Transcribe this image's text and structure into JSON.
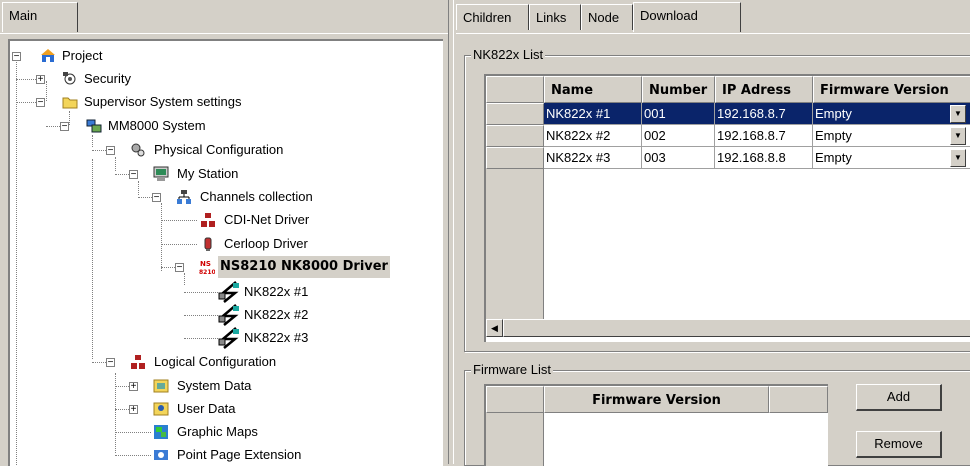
{
  "left_tabs": {
    "main": "Main"
  },
  "tree": [
    {
      "label": "Project",
      "level": 0,
      "expander": "−"
    },
    {
      "label": "Security",
      "level": 1,
      "expander": "+"
    },
    {
      "label": "Supervisor System settings",
      "level": 1,
      "expander": "−"
    },
    {
      "label": "MM8000 System",
      "level": 2,
      "expander": "−"
    },
    {
      "label": "Physical Configuration",
      "level": 3,
      "expander": "−"
    },
    {
      "label": "My Station",
      "level": 4,
      "expander": "−"
    },
    {
      "label": "Channels collection",
      "level": 5,
      "expander": "−"
    },
    {
      "label": "CDI-Net Driver",
      "level": 6,
      "expander": ""
    },
    {
      "label": "Cerloop Driver",
      "level": 6,
      "expander": ""
    },
    {
      "label": "NS8210 NK8000 Driver",
      "level": 6,
      "expander": "−",
      "selected": true
    },
    {
      "label": "NK822x #1",
      "level": 7,
      "expander": ""
    },
    {
      "label": "NK822x #2",
      "level": 7,
      "expander": ""
    },
    {
      "label": "NK822x #3",
      "level": 7,
      "expander": ""
    },
    {
      "label": "Logical Configuration",
      "level": 3,
      "expander": "−"
    },
    {
      "label": "System Data",
      "level": 4,
      "expander": "+"
    },
    {
      "label": "User Data",
      "level": 4,
      "expander": "+"
    },
    {
      "label": "Graphic Maps",
      "level": 4,
      "expander": ""
    },
    {
      "label": "Point Page Extension",
      "level": 4,
      "expander": ""
    }
  ],
  "right_tabs": {
    "children": "Children",
    "links": "Links",
    "node": "Node",
    "download": "Download"
  },
  "nk_list": {
    "title": "NK822x List",
    "headers": {
      "name": "Name",
      "number": "Number",
      "ip": "IP Adress",
      "firmware": "Firmware Version"
    },
    "rows": [
      {
        "name": "NK822x #1",
        "number": "001",
        "ip": "192.168.8.7",
        "firmware": "Empty"
      },
      {
        "name": "NK822x #2",
        "number": "002",
        "ip": "192.168.8.7",
        "firmware": "Empty"
      },
      {
        "name": "NK822x #3",
        "number": "003",
        "ip": "192.168.8.8",
        "firmware": "Empty"
      }
    ]
  },
  "firmware_list": {
    "title": "Firmware List",
    "header": "Firmware Version",
    "add_label": "Add",
    "remove_label": "Remove"
  },
  "colors": {
    "selection": "#0a246a",
    "face": "#d4d0c8"
  },
  "icons": [
    "project-icon",
    "security-icon",
    "folder-icon",
    "system-icon",
    "physical-config-icon",
    "station-icon",
    "channels-icon",
    "driver-icon",
    "cerloop-icon",
    "ns8210-icon",
    "nk822x-icon",
    "logical-config-icon",
    "system-data-icon",
    "user-data-icon",
    "graphic-maps-icon",
    "point-page-icon"
  ]
}
